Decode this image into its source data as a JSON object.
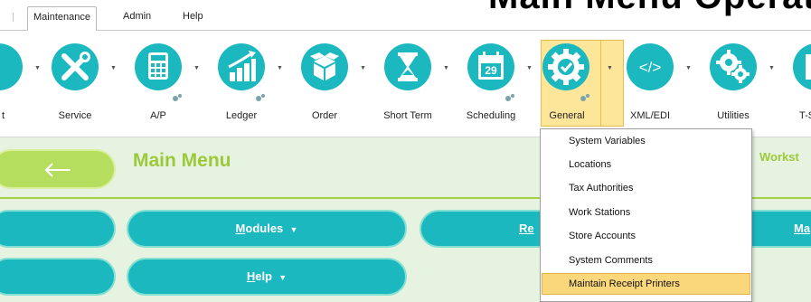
{
  "tabs": [
    {
      "label": "Maintenance",
      "active": true
    },
    {
      "label": "Admin",
      "active": false
    },
    {
      "label": "Help",
      "active": false
    }
  ],
  "page_heading": "Main Menu Operations",
  "ribbon": {
    "items": [
      {
        "label": "t",
        "icon": "clipboard-icon"
      },
      {
        "label": "Service",
        "icon": "wrench-screwdriver-icon"
      },
      {
        "label": "A/P",
        "icon": "calculator-icon"
      },
      {
        "label": "Ledger",
        "icon": "bar-chart-growth-icon"
      },
      {
        "label": "Order",
        "icon": "box-icon"
      },
      {
        "label": "Short Term",
        "icon": "hourglass-icon"
      },
      {
        "label": "Scheduling",
        "icon": "calendar-icon"
      },
      {
        "label": "General",
        "icon": "gear-badge-icon"
      },
      {
        "label": "XML/EDI",
        "icon": "code-icon"
      },
      {
        "label": "Utilities",
        "icon": "gears-icon"
      },
      {
        "label": "T-S",
        "icon": "document-icon"
      }
    ],
    "calendar_day": "29",
    "xml_glyph": "</>"
  },
  "main": {
    "title": "Main Menu",
    "workstation_label": "Workst",
    "back_arrow": "←",
    "buttons": {
      "modules_first": "M",
      "modules_rest": "odules",
      "help_first": "H",
      "help_rest": "elp",
      "reports_clip": "Re",
      "maint_clip": "Ma",
      "caret": "▼"
    }
  },
  "dropdown": {
    "items": [
      {
        "label": "System Variables",
        "selected": false
      },
      {
        "label": "Locations",
        "selected": false
      },
      {
        "label": "Tax Authorities",
        "selected": false
      },
      {
        "label": "Work Stations",
        "selected": false
      },
      {
        "label": "Store Accounts",
        "selected": false
      },
      {
        "label": "System Comments",
        "selected": false
      },
      {
        "label": "Maintain Receipt Printers",
        "selected": true
      }
    ]
  },
  "colors": {
    "teal": "#1bb8c0",
    "lime": "#9cc93a",
    "panel": "#e6f3e0",
    "highlight": "#fbd77c"
  }
}
